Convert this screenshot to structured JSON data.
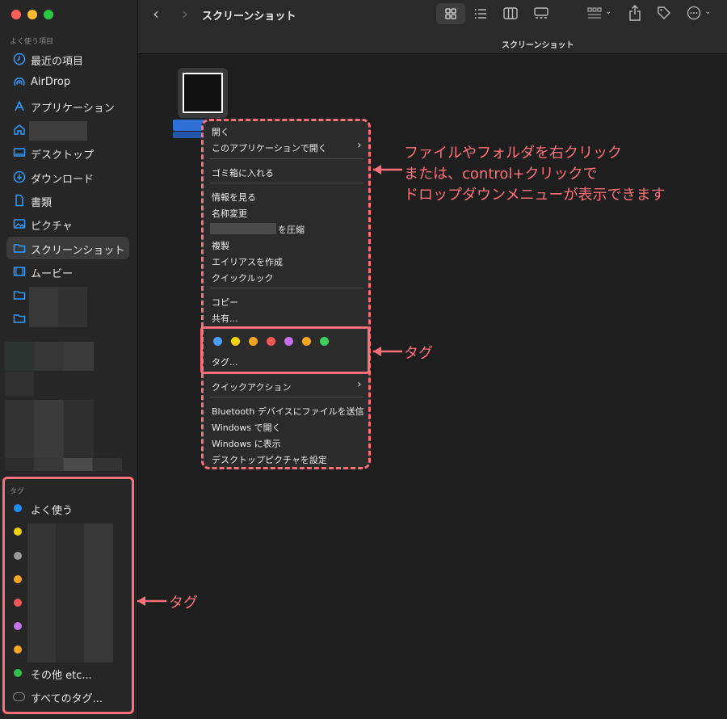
{
  "window": {
    "traffic_lights": {
      "close": "#ff5f57",
      "minimize": "#febc2e",
      "zoom": "#28c840"
    },
    "title": "スクリーンショット",
    "path_title": "スクリーンショット"
  },
  "toolbar": {
    "back_icon": "chevron-left-icon",
    "forward_icon": "chevron-right-icon",
    "view_icons": [
      "icon-view-icon",
      "list-view-icon",
      "column-view-icon",
      "gallery-view-icon"
    ],
    "group_icon": "group-icon",
    "share_icon": "share-icon",
    "tag_icon": "tag-icon",
    "more_icon": "more-icon"
  },
  "sidebar": {
    "favorites_label": "よく使う項目",
    "items": [
      {
        "label": "最近の項目",
        "icon": "clock-icon"
      },
      {
        "label": "AirDrop",
        "icon": "airdrop-icon"
      },
      {
        "label": "アプリケーション",
        "icon": "applications-icon"
      },
      {
        "label": "",
        "icon": "home-icon"
      },
      {
        "label": "デスクトップ",
        "icon": "desktop-icon"
      },
      {
        "label": "ダウンロード",
        "icon": "download-icon"
      },
      {
        "label": "書類",
        "icon": "document-icon"
      },
      {
        "label": "ピクチャ",
        "icon": "pictures-icon"
      },
      {
        "label": "スクリーンショット",
        "icon": "folder-icon",
        "selected": true
      },
      {
        "label": "ムービー",
        "icon": "movies-icon"
      }
    ],
    "tags_label": "タグ",
    "tags": [
      {
        "label": "よく使う",
        "color": "#1e8cf5"
      },
      {
        "label": "",
        "color": "#f5d20a"
      },
      {
        "label": "",
        "color": "#9a9a9a"
      },
      {
        "label": "",
        "color": "#f5a623"
      },
      {
        "label": "",
        "color": "#f45a55"
      },
      {
        "label": "",
        "color": "#c471ed"
      },
      {
        "label": "",
        "color": "#f5a623"
      },
      {
        "label": "その他 etc...",
        "color": "#2ec24a"
      },
      {
        "label": "すべてのタグ...",
        "color": "#888888"
      }
    ]
  },
  "context_menu": {
    "items": [
      "開く",
      "このアプリケーションで開く",
      "ゴミ箱に入れる",
      "情報を見る",
      "名称変更",
      "を圧縮",
      "複製",
      "エイリアスを作成",
      "クイックルック",
      "コピー",
      "共有...",
      "タグ...",
      "クイックアクション",
      "Bluetooth デバイスにファイルを送信",
      "Windows で開く",
      "Windows に表示",
      "デスクトップピクチャを設定"
    ],
    "tag_colors": [
      "#4a9ff5",
      "#f5d20a",
      "#f5a623",
      "#f45a55",
      "#c471ed",
      "#f5a623",
      "#3fce5c"
    ]
  },
  "annotations": {
    "menu_note_lines": [
      "ファイルやフォルダを右クリック",
      "または、control+クリックで",
      "ドロップダウンメニューが表示できます"
    ],
    "tag_note": "タグ",
    "sidebar_tag_note": "タグ",
    "accent": "#ff6f7a"
  }
}
